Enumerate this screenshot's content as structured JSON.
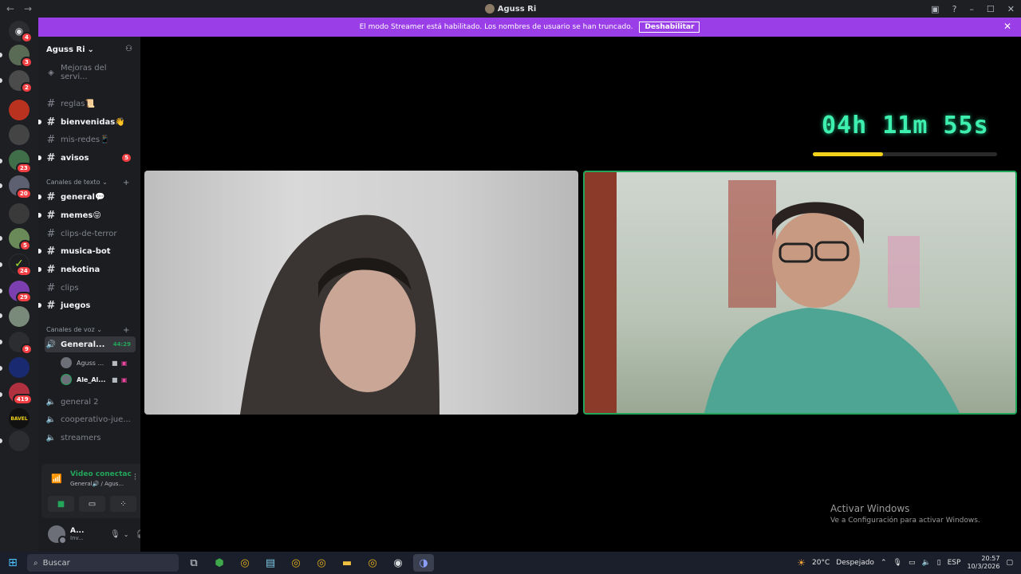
{
  "window": {
    "title": "Aguss Ri",
    "back_icon": "←",
    "forward_icon": "→",
    "minimize": "–",
    "maximize": "☐",
    "close": "✕"
  },
  "banner": {
    "text": "El modo Streamer está habilitado. Los nombres de usuario se han truncado.",
    "button": "Deshabilitar",
    "close": "✕"
  },
  "guilds": {
    "badges": [
      "4",
      "3",
      "2",
      "23",
      "20",
      "5",
      "24",
      "29",
      "9",
      "419"
    ],
    "text_icon": "BAVEL"
  },
  "sidebar": {
    "server_name": "Aguss Ri",
    "server_chevron": "⌄",
    "boost_item": "Mejoras del servi...",
    "channels_top": [
      {
        "name": "reglas📜",
        "unread": false
      },
      {
        "name": "bienvenidas👋",
        "unread": true
      },
      {
        "name": "mis-redes📱",
        "unread": false
      },
      {
        "name": "avisos",
        "unread": true,
        "badge": "5"
      }
    ],
    "text_category": "Canales de texto",
    "text_channels": [
      {
        "name": "general💬",
        "unread": true
      },
      {
        "name": "memes😝",
        "unread": true
      },
      {
        "name": "clips-de-terror",
        "unread": false
      },
      {
        "name": "musica-bot",
        "unread": true
      },
      {
        "name": "nekotina",
        "unread": true
      },
      {
        "name": "clips",
        "unread": false
      },
      {
        "name": "juegos",
        "unread": true
      }
    ],
    "voice_category": "Canales de voz",
    "voice_active": {
      "name": "General...",
      "time": "44:29"
    },
    "voice_users": [
      {
        "name": "Aguss ..."
      },
      {
        "name": "Ale_Al..."
      }
    ],
    "voice_channels": [
      "general 2",
      "cooperativo-jue...",
      "streamers"
    ]
  },
  "rtc": {
    "status": "Video conectac",
    "sub": "General🔊 / Agus..."
  },
  "user": {
    "name": "A...",
    "status": "Inv..."
  },
  "stage": {
    "timer": "04h 11m 55s",
    "progress": 0.38
  },
  "activate": {
    "title": "Activar Windows",
    "sub": "Ve a Configuración para activar Windows."
  },
  "taskbar": {
    "search": "Buscar",
    "weather": "20°C",
    "weather_desc": "Despejado",
    "lang": "ESP",
    "time": "20:57",
    "date": "10/3/2026"
  },
  "colors": {
    "banner": "#9a3ee8",
    "timer": "#3ef0b0",
    "progress": "#f2d21b",
    "speaking_border": "#23a55a"
  }
}
